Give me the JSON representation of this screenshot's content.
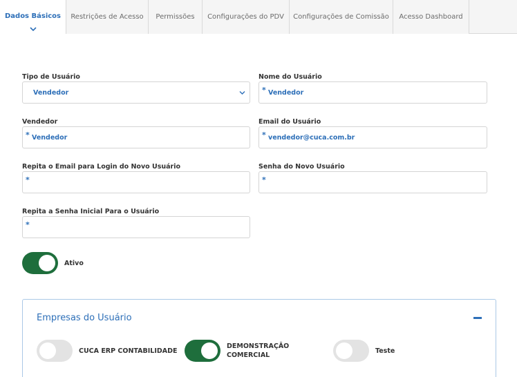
{
  "tabs": [
    {
      "label": "Dados Básicos",
      "active": true
    },
    {
      "label": "Restrições de Acesso"
    },
    {
      "label": "Permissões"
    },
    {
      "label": "Configurações do PDV"
    },
    {
      "label": "Configurações de Comissão"
    },
    {
      "label": "Acesso Dashboard"
    }
  ],
  "form": {
    "tipo_usuario": {
      "label": "Tipo de Usuário",
      "value": "Vendedor"
    },
    "nome_usuario": {
      "label": "Nome do Usuário",
      "value": "Vendedor"
    },
    "vendedor": {
      "label": "Vendedor",
      "value": "Vendedor"
    },
    "email": {
      "label": "Email do Usuário",
      "value": "vendedor@cuca.com.br"
    },
    "repita_email": {
      "label": "Repita o Email para Login do Novo Usuário",
      "value": ""
    },
    "senha": {
      "label": "Senha do Novo Usuário",
      "value": ""
    },
    "repita_senha": {
      "label": "Repita a Senha Inicial Para o Usuário",
      "value": ""
    },
    "required_mark": "*"
  },
  "ativo": {
    "label": "Ativo",
    "on": true
  },
  "empresas": {
    "title": "Empresas do Usuário",
    "items": [
      {
        "label": "CUCA ERP CONTABILIDADE",
        "on": false
      },
      {
        "label_line1": "DEMONSTRAÇÃO",
        "label_line2": "COMERCIAL",
        "on": true
      },
      {
        "label": "Teste",
        "on": false
      }
    ]
  },
  "colors": {
    "accent": "#2d6fb8",
    "toggle_on": "#1e6e3c",
    "toggle_off": "#e3e3e3"
  },
  "icons": {
    "tab_indicator": "chevron-down-icon",
    "select_caret": "chevron-down-icon",
    "panel_toggle": "minus-icon"
  }
}
